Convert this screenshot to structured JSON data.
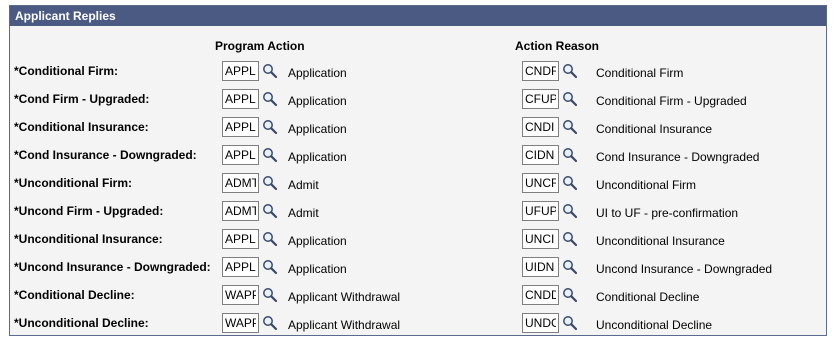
{
  "panel": {
    "title": "Applicant Replies"
  },
  "columns": {
    "program_action": "Program Action",
    "action_reason": "Action Reason"
  },
  "rows": [
    {
      "label": "*Conditional Firm:",
      "program_code": "APPL",
      "program_desc": "Application",
      "reason_code": "CNDF",
      "reason_desc": "Conditional Firm"
    },
    {
      "label": "*Cond Firm - Upgraded:",
      "program_code": "APPL",
      "program_desc": "Application",
      "reason_code": "CFUP",
      "reason_desc": "Conditional Firm - Upgraded"
    },
    {
      "label": "*Conditional Insurance:",
      "program_code": "APPL",
      "program_desc": "Application",
      "reason_code": "CNDI",
      "reason_desc": "Conditional Insurance"
    },
    {
      "label": "*Cond Insurance - Downgraded:",
      "program_code": "APPL",
      "program_desc": "Application",
      "reason_code": "CIDN",
      "reason_desc": "Cond Insurance - Downgraded"
    },
    {
      "label": "*Unconditional Firm:",
      "program_code": "ADMT",
      "program_desc": "Admit",
      "reason_code": "UNCF",
      "reason_desc": "Unconditional Firm"
    },
    {
      "label": "*Uncond Firm - Upgraded:",
      "program_code": "ADMT",
      "program_desc": "Admit",
      "reason_code": "UFUP",
      "reason_desc": "UI to UF - pre-confirmation"
    },
    {
      "label": "*Unconditional Insurance:",
      "program_code": "APPL",
      "program_desc": "Application",
      "reason_code": "UNCI",
      "reason_desc": "Unconditional Insurance"
    },
    {
      "label": "*Uncond Insurance - Downgraded:",
      "program_code": "APPL",
      "program_desc": "Application",
      "reason_code": "UIDN",
      "reason_desc": "Uncond Insurance - Downgraded"
    },
    {
      "label": "*Conditional Decline:",
      "program_code": "WAPP",
      "program_desc": "Applicant Withdrawal",
      "reason_code": "CNDD",
      "reason_desc": "Conditional Decline"
    },
    {
      "label": "*Unconditional Decline:",
      "program_code": "WAPP",
      "program_desc": "Applicant Withdrawal",
      "reason_code": "UNDC",
      "reason_desc": "Unconditional Decline"
    }
  ],
  "icons": {
    "lookup": "magnifier-icon"
  },
  "colors": {
    "header_bg": "#4a5a82",
    "body_bg": "#f4f4f4"
  }
}
